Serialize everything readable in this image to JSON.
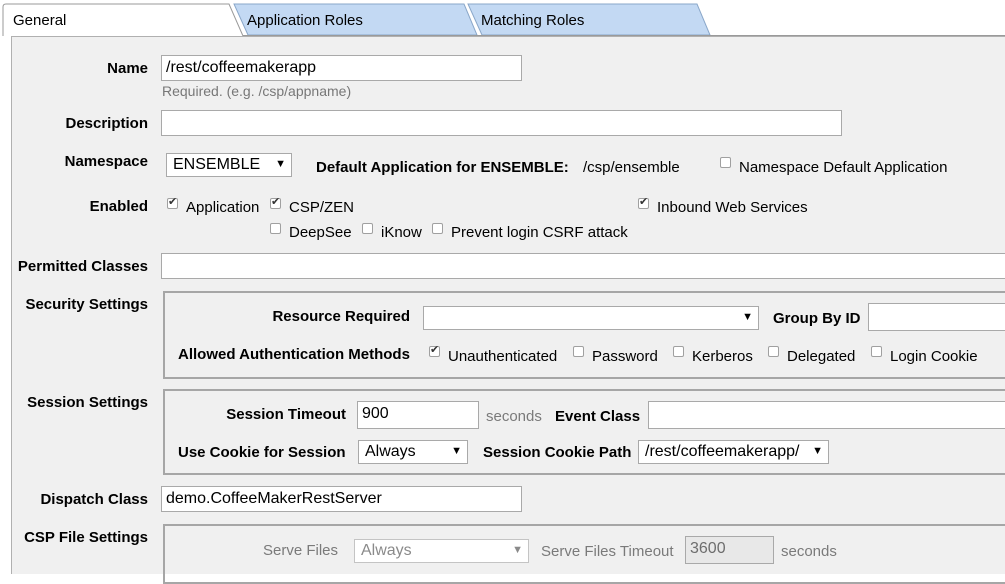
{
  "tabs": [
    {
      "label": "General"
    },
    {
      "label": "Application Roles"
    },
    {
      "label": "Matching Roles"
    }
  ],
  "form": {
    "name": {
      "label": "Name",
      "value": "/rest/coffeemakerapp",
      "hint": "Required. (e.g. /csp/appname)"
    },
    "description": {
      "label": "Description",
      "value": ""
    },
    "namespace": {
      "label": "Namespace",
      "selected": "ENSEMBLE",
      "default_app_label": "Default Application for ENSEMBLE:",
      "default_app_value": "/csp/ensemble",
      "namespace_default_label": "Namespace Default Application"
    },
    "enabled": {
      "label": "Enabled",
      "application": "Application",
      "cspzen": "CSP/ZEN",
      "inbound": "Inbound Web Services",
      "deepsee": "DeepSee",
      "iknow": "iKnow",
      "csrf": "Prevent login CSRF attack"
    },
    "permitted_classes": {
      "label": "Permitted Classes",
      "value": ""
    },
    "security": {
      "label": "Security Settings",
      "resource_label": "Resource Required",
      "resource_value": "",
      "group_label": "Group By ID",
      "auth_label": "Allowed Authentication Methods",
      "methods": [
        "Unauthenticated",
        "Password",
        "Kerberos",
        "Delegated",
        "Login Cookie"
      ]
    },
    "session": {
      "label": "Session Settings",
      "timeout_label": "Session Timeout",
      "timeout_value": "900",
      "timeout_unit": "seconds",
      "event_class_label": "Event Class",
      "cookie_label": "Use Cookie for Session",
      "cookie_value": "Always",
      "cookie_path_label": "Session Cookie Path",
      "cookie_path_value": "/rest/coffeemakerapp/"
    },
    "dispatch": {
      "label": "Dispatch Class",
      "value": "demo.CoffeeMakerRestServer"
    },
    "csp_files": {
      "label": "CSP File Settings",
      "serve_label": "Serve Files",
      "serve_value": "Always",
      "timeout_label": "Serve Files Timeout",
      "timeout_value": "3600",
      "timeout_unit": "seconds"
    }
  },
  "colors": {
    "tab_active": "#ffffff",
    "tab_inactive": "#c3d9f3",
    "panel": "#f0f0f0"
  }
}
